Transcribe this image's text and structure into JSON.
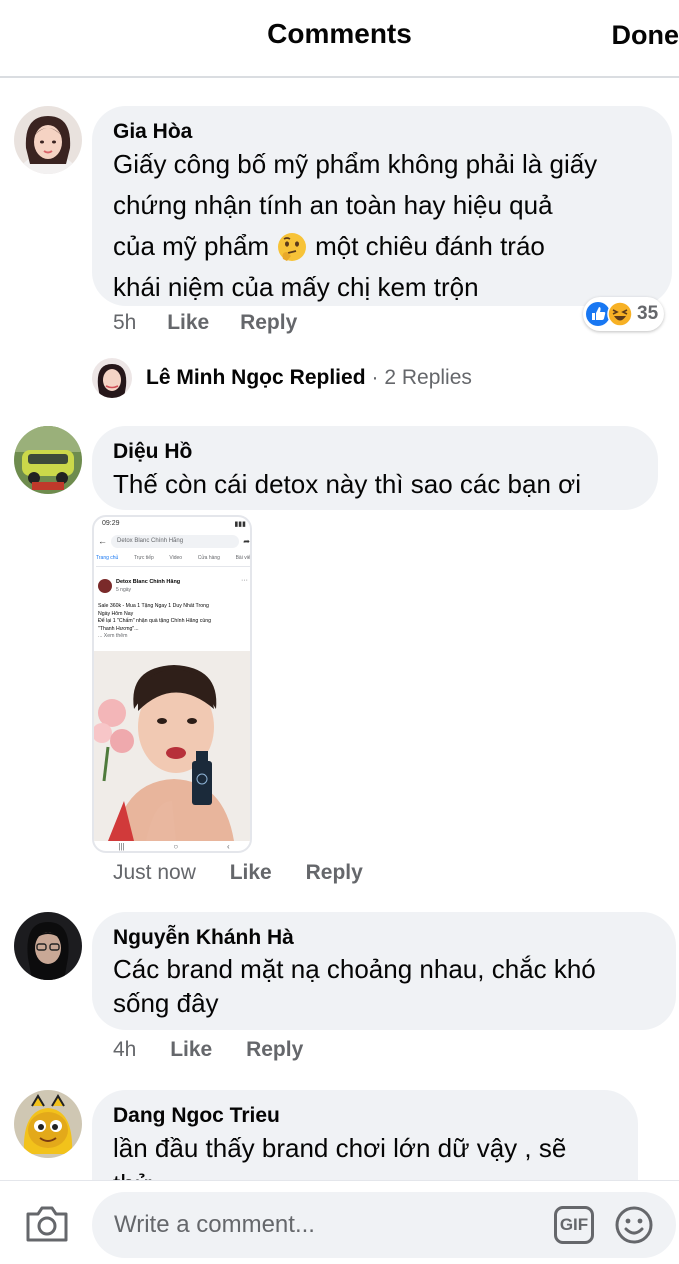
{
  "header": {
    "title": "Comments",
    "done_label": "Done"
  },
  "comments": [
    {
      "author": "Gia Hòa",
      "lines": [
        "Giấy công bố mỹ phẩm không phải là giấy",
        "chứng nhận tính an toàn hay hiệu quả",
        "của mỹ phẩm",
        "một chiêu đánh tráo",
        "khái niệm của mấy chị kem trộn"
      ],
      "time": "5h",
      "like": "Like",
      "reply": "Reply",
      "reaction_count": "35",
      "replies": {
        "name": "Lê Minh Ngọc",
        "word": "Replied",
        "count": "· 2 Replies"
      }
    },
    {
      "author": "Diệu Hồ",
      "lines": [
        "Thế còn cái detox  này thì sao các bạn ơi"
      ],
      "time": "Just now",
      "like": "Like",
      "reply": "Reply",
      "screenshot": {
        "status_time": "09:29",
        "search": "Detox Blanc Chính Hãng",
        "tabs": [
          "Trang chủ",
          "Trực tiếp",
          "Video",
          "Cửa hàng",
          "Bài viết"
        ],
        "page_name": "Detox Blanc Chính Hãng",
        "post_meta": "5 ngày",
        "post_lines": [
          "Sale 360k - Mua 1 Tặng Ngay 1 Duy Nhất Trong",
          "Ngày Hôm Nay",
          "Để lại 1 \"Chấm\" nhận quà tặng Chính Hãng cùng",
          "\"Thanh Hương\"...",
          "... Xem thêm"
        ]
      }
    },
    {
      "author": "Nguyễn Khánh Hà",
      "lines": [
        "Các brand mặt nạ choảng nhau, chắc khó",
        "sống đây"
      ],
      "time": "4h",
      "like": "Like",
      "reply": "Reply"
    },
    {
      "author": "Dang Ngoc Trieu",
      "lines": [
        "lần đầu thấy brand chơi lớn dữ vậy , sẽ",
        "thử"
      ]
    }
  ],
  "composer": {
    "placeholder": "Write a comment...",
    "gif_label": "GIF"
  },
  "icons": {
    "camera": "camera-icon",
    "emoji": "emoji-icon",
    "gif": "gif-icon",
    "like_reaction": "like-reaction-icon",
    "haha_reaction": "haha-reaction-icon"
  },
  "colors": {
    "bubble": "#f0f2f5",
    "secondary_text": "#65676b",
    "like_blue": "#1877f2",
    "haha_yellow": "#f7b125"
  }
}
